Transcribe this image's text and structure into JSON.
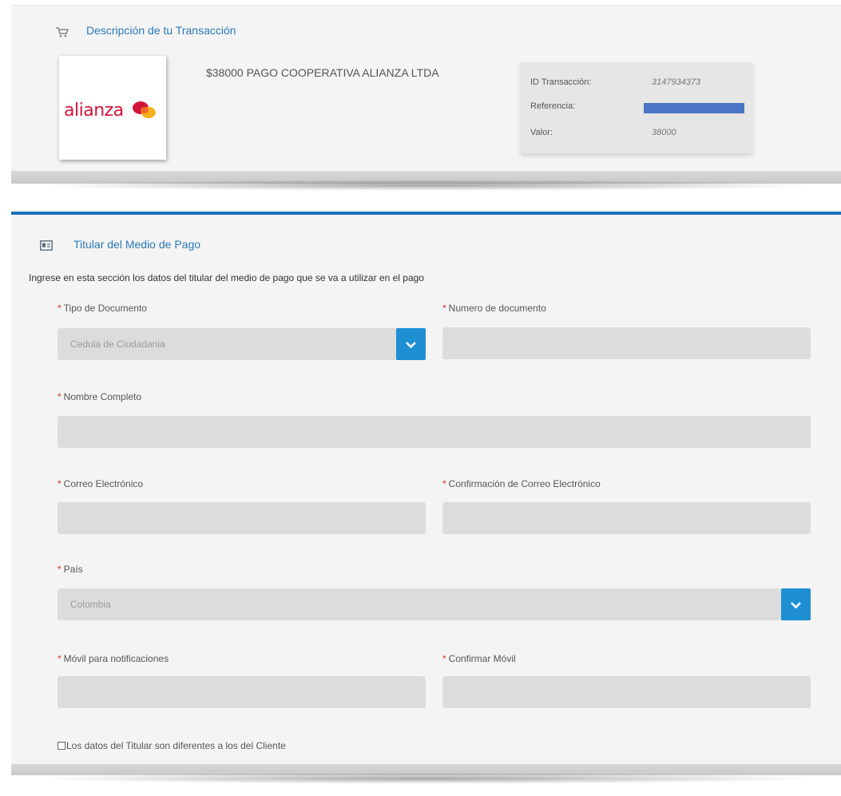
{
  "transaction": {
    "section_title": "Descripción de tu Transacción",
    "logo_text": "alianza",
    "description": "$38000 PAGO COOPERATIVA ALIANZA LTDA",
    "id_label": "ID Transacción:",
    "id_value": "3147934373",
    "reference_label": "Referencia:",
    "value_label": "Valor:",
    "value_value": "38000"
  },
  "holder": {
    "section_title": "Titular del Medio de Pago",
    "intro": "Ingrese en esta sección los datos del titular del medio de pago que se va a utilizar en el pago",
    "required_mark": "*",
    "fields": {
      "doc_type": {
        "label": "Tipo de Documento",
        "value": "Cedula de Ciudadania"
      },
      "doc_number": {
        "label": "Numero de documento",
        "value": ""
      },
      "full_name": {
        "label": "Nombre Completo",
        "value": ""
      },
      "email": {
        "label": "Correo Electrónico",
        "value": ""
      },
      "email_confirm": {
        "label": "Confirmación de Correo Electrónico",
        "value": ""
      },
      "country": {
        "label": "País",
        "value": "Colombia"
      },
      "mobile": {
        "label": "Móvil para notificaciones",
        "value": ""
      },
      "mobile_confirm": {
        "label": "Confirmar Móvil",
        "value": ""
      }
    },
    "checkbox_label": "Los datos del Titular son diferentes a los del Cliente",
    "checkbox_checked": false
  },
  "colors": {
    "accent_blue": "#1e6fb8",
    "title_blue": "#2b79b9",
    "select_button": "#1e8fd3",
    "required_red": "#d9342b",
    "input_bg": "#dcdcdc",
    "redaction": "#4b74c7"
  },
  "icons": {
    "transaction": "shopping-cart-icon",
    "holder": "credit-card-icon",
    "select": "chevron-down-icon"
  }
}
